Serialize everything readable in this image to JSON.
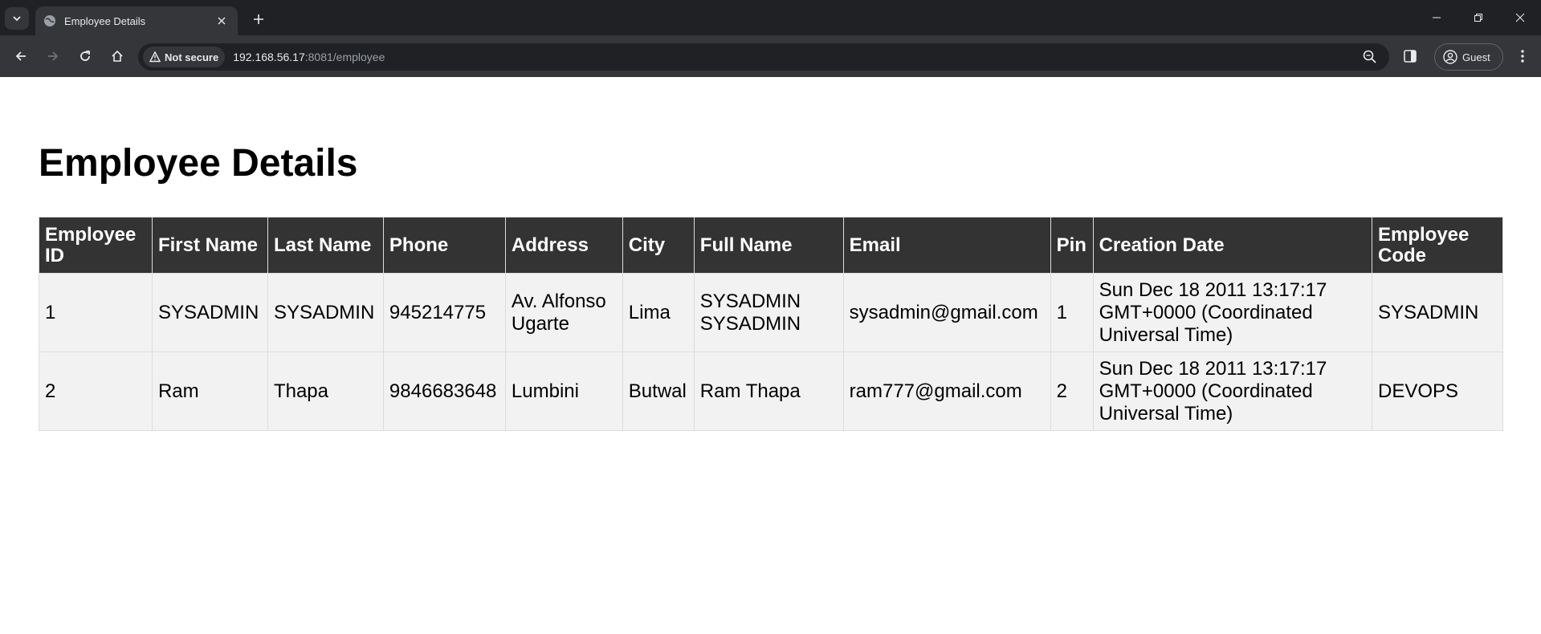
{
  "browser": {
    "tab_title": "Employee Details",
    "security_label": "Not secure",
    "url_host": "192.168.56.17",
    "url_path": ":8081/employee",
    "profile_label": "Guest"
  },
  "page": {
    "heading": "Employee Details",
    "columns": [
      "Employee ID",
      "First Name",
      "Last Name",
      "Phone",
      "Address",
      "City",
      "Full Name",
      "Email",
      "Pin",
      "Creation Date",
      "Employee Code"
    ],
    "rows": [
      {
        "id": "1",
        "first_name": "SYSADMIN",
        "last_name": "SYSADMIN",
        "phone": "945214775",
        "address": "Av. Alfonso Ugarte",
        "city": "Lima",
        "full_name": "SYSADMIN SYSADMIN",
        "email": "sysadmin@gmail.com",
        "pin": "1",
        "creation_date": "Sun Dec 18 2011 13:17:17 GMT+0000 (Coordinated Universal Time)",
        "employee_code": "SYSADMIN"
      },
      {
        "id": "2",
        "first_name": "Ram",
        "last_name": "Thapa",
        "phone": "9846683648",
        "address": "Lumbini",
        "city": "Butwal",
        "full_name": "Ram Thapa",
        "email": "ram777@gmail.com",
        "pin": "2",
        "creation_date": "Sun Dec 18 2011 13:17:17 GMT+0000 (Coordinated Universal Time)",
        "employee_code": "DEVOPS"
      }
    ]
  },
  "colors": {
    "header_bg": "#333333",
    "header_text": "#ffffff",
    "cell_bg": "#f2f2f2",
    "border": "#dddddd"
  },
  "icons": [
    "tab-search-icon",
    "globe-icon",
    "close-icon",
    "plus-icon",
    "minimize-icon",
    "restore-icon",
    "back-icon",
    "forward-icon",
    "reload-icon",
    "home-icon",
    "warning-icon",
    "zoom-icon",
    "side-panel-icon",
    "profile-icon",
    "menu-icon"
  ]
}
